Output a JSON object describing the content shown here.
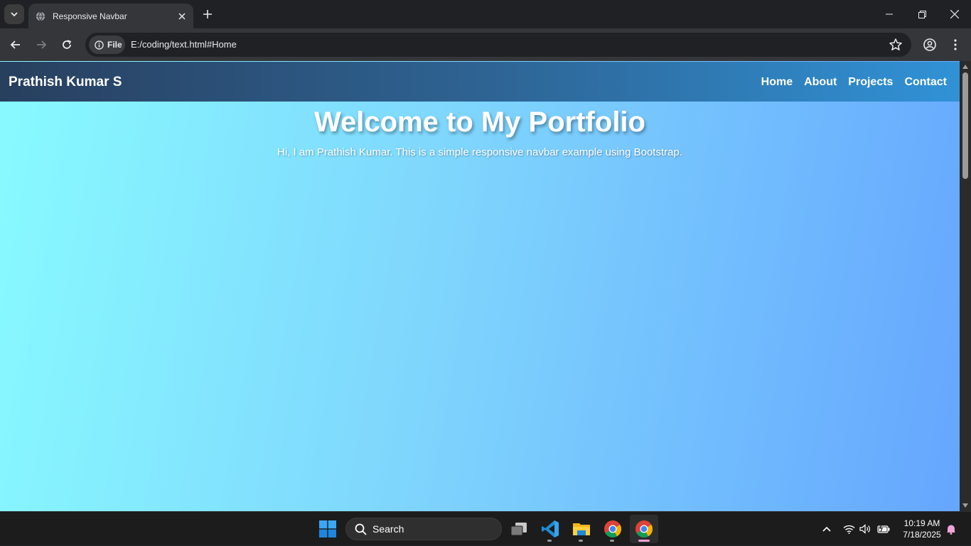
{
  "browser": {
    "tab_title": "Responsive Navbar",
    "chip_label": "File",
    "url": "E:/coding/text.html#Home"
  },
  "page": {
    "brand": "Prathish Kumar S",
    "nav_links": [
      "Home",
      "About",
      "Projects",
      "Contact"
    ],
    "hero_title": "Welcome to My Portfolio",
    "hero_subtitle": "Hi, I am Prathish Kumar. This is a simple responsive navbar example using Bootstrap.",
    "colors": {
      "gradient_left": "#88fbff",
      "gradient_right": "#65a6fe",
      "navbar_left": "#283f5e",
      "navbar_right": "#3092d6"
    }
  },
  "taskbar": {
    "search_label": "Search",
    "apps": [
      "windows-start",
      "task-view",
      "vscode",
      "file-explorer",
      "chrome",
      "chrome-active"
    ],
    "time": "10:19 AM",
    "date": "7/18/2025"
  }
}
